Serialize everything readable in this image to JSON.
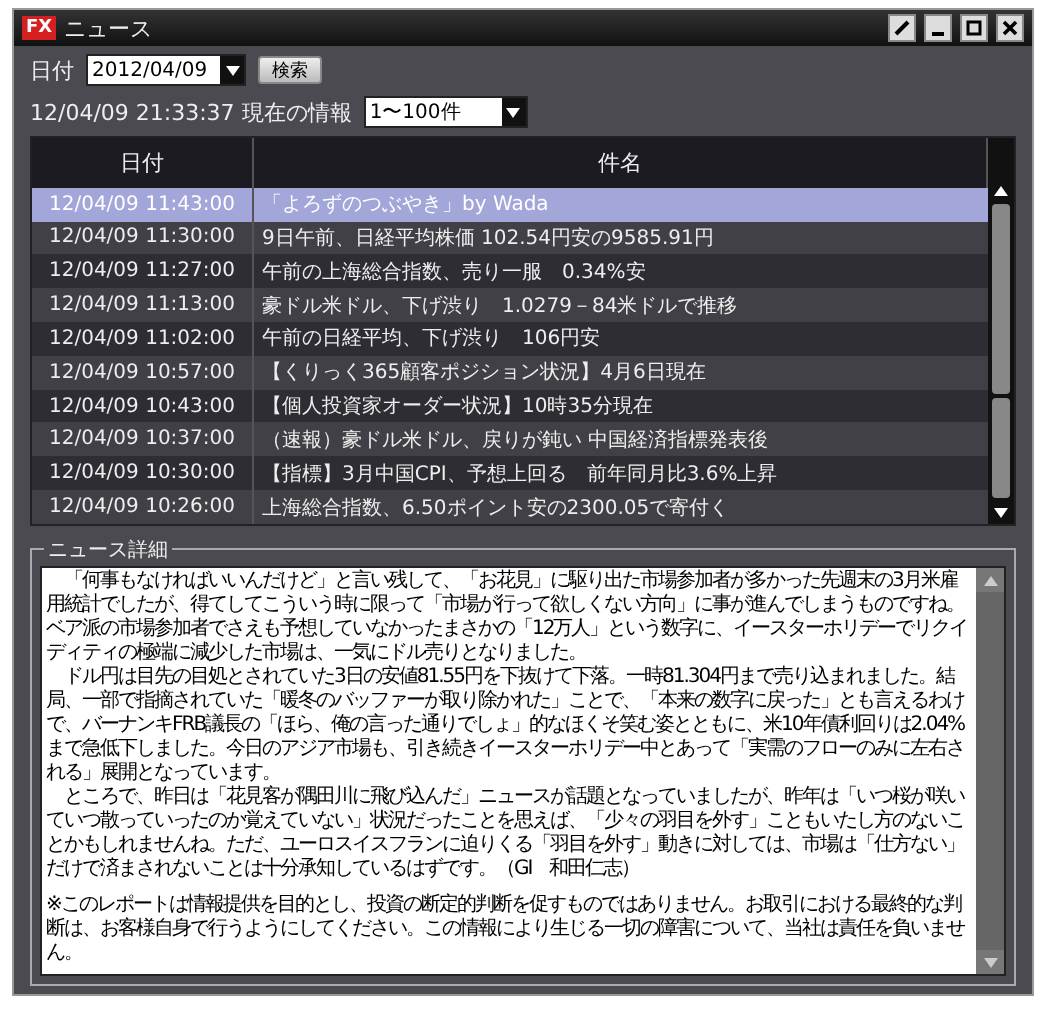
{
  "window": {
    "title": "ニュース",
    "logo": "FX"
  },
  "toolbar": {
    "date_label": "日付",
    "date_value": "2012/04/09",
    "search_button": "検索"
  },
  "status": {
    "timestamp": "12/04/09 21:33:37 現在の情報",
    "range_value": "1〜100件"
  },
  "table": {
    "columns": [
      "日付",
      "件名"
    ],
    "rows": [
      {
        "date": "12/04/09 11:43:00",
        "subject": "「よろずのつぶやき」by Wada",
        "selected": true
      },
      {
        "date": "12/04/09 11:30:00",
        "subject": "9日午前、日経平均株価 102.54円安の9585.91円",
        "selected": false
      },
      {
        "date": "12/04/09 11:27:00",
        "subject": "午前の上海総合指数、売り一服　0.34%安",
        "selected": false
      },
      {
        "date": "12/04/09 11:13:00",
        "subject": "豪ドル米ドル、下げ渋り　1.0279－84米ドルで推移",
        "selected": false
      },
      {
        "date": "12/04/09 11:02:00",
        "subject": "午前の日経平均、下げ渋り　106円安",
        "selected": false
      },
      {
        "date": "12/04/09 10:57:00",
        "subject": "【くりっく365顧客ポジション状況】4月6日現在",
        "selected": false
      },
      {
        "date": "12/04/09 10:43:00",
        "subject": "【個人投資家オーダー状況】10時35分現在",
        "selected": false
      },
      {
        "date": "12/04/09 10:37:00",
        "subject": "（速報）豪ドル米ドル、戻りが鈍い 中国経済指標発表後",
        "selected": false
      },
      {
        "date": "12/04/09 10:30:00",
        "subject": "【指標】3月中国CPI、予想上回る　前年同月比3.6%上昇",
        "selected": false
      },
      {
        "date": "12/04/09 10:26:00",
        "subject": "上海総合指数、6.50ポイント安の2300.05で寄付く",
        "selected": false
      }
    ]
  },
  "detail": {
    "title": "ニュース詳細",
    "paragraphs": [
      "　「何事もなければいいんだけど」と言い残して、「お花見」に駆り出た市場参加者が多かった先週末の3月米雇用統計でしたが、得てしてこういう時に限って「市場が行って欲しくない方向」に事が進んでしまうものですね。ベア派の市場参加者でさえも予想していなかったまさかの「12万人」という数字に、イースターホリデーでリクイディティの極端に減少した市場は、一気にドル売りとなりました。",
      "　ドル円は目先の目処とされていた3日の安値81.55円を下抜けて下落。一時81.304円まで売り込まれました。結局、一部で指摘されていた「暖冬のバッファーが取り除かれた」ことで、「本来の数字に戻った」とも言えるわけで、バーナンキFRB議長の「ほら、俺の言った通りでしょ」的なほくそ笑む姿とともに、米10年債利回りは2.04%まで急低下しました。今日のアジア市場も、引き続きイースターホリデー中とあって「実需のフローのみに左右される」展開となっています。",
      "　ところで、昨日は「花見客が隅田川に飛び込んだ」ニュースが話題となっていましたが、昨年は「いつ桜が咲いていつ散っていったのか覚えていない」状況だったことを思えば、「少々の羽目を外す」こともいたし方のないことかもしれませんね。ただ、ユーロスイスフランに迫りくる「羽目を外す」動きに対しては、市場は「仕方ない」だけで済まされないことは十分承知しているはずです。（GI　和田仁志）",
      "※このレポートは情報提供を目的とし、投資の断定的判断を促すものではありません。お取引における最終的な判断は、お客様自身で行うようにしてください。この情報により生じる一切の障害について、当社は責任を負いません。"
    ]
  }
}
